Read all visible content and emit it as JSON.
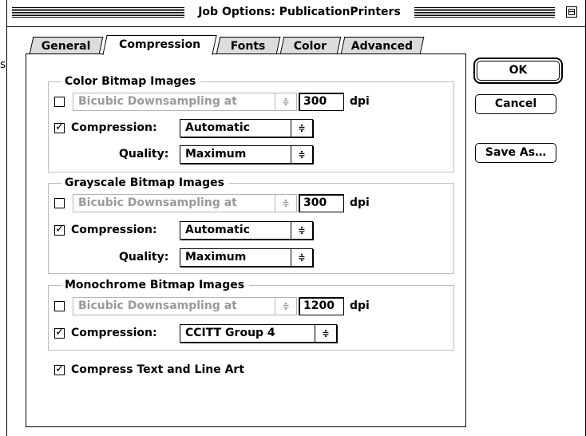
{
  "window": {
    "title": "Job Options: PublicationPrinters"
  },
  "tabs": [
    {
      "label": "General"
    },
    {
      "label": "Compression"
    },
    {
      "label": "Fonts"
    },
    {
      "label": "Color"
    },
    {
      "label": "Advanced"
    }
  ],
  "groups": {
    "color": {
      "title": "Color Bitmap Images",
      "downsample_label": "Bicubic Downsampling at",
      "dpi_value": "300",
      "dpi_unit": "dpi",
      "compression_label": "Compression:",
      "compression_value": "Automatic",
      "quality_label": "Quality:",
      "quality_value": "Maximum"
    },
    "grayscale": {
      "title": "Grayscale Bitmap Images",
      "downsample_label": "Bicubic Downsampling at",
      "dpi_value": "300",
      "dpi_unit": "dpi",
      "compression_label": "Compression:",
      "compression_value": "Automatic",
      "quality_label": "Quality:",
      "quality_value": "Maximum"
    },
    "mono": {
      "title": "Monochrome Bitmap Images",
      "downsample_label": "Bicubic Downsampling at",
      "dpi_value": "1200",
      "dpi_unit": "dpi",
      "compression_label": "Compression:",
      "compression_value": "CCITT Group 4"
    }
  },
  "compress_text_label": "Compress Text and Line Art",
  "buttons": {
    "ok": "OK",
    "cancel": "Cancel",
    "save_as": "Save As…"
  },
  "arrows_glyph": "≑",
  "stray_text": "s."
}
